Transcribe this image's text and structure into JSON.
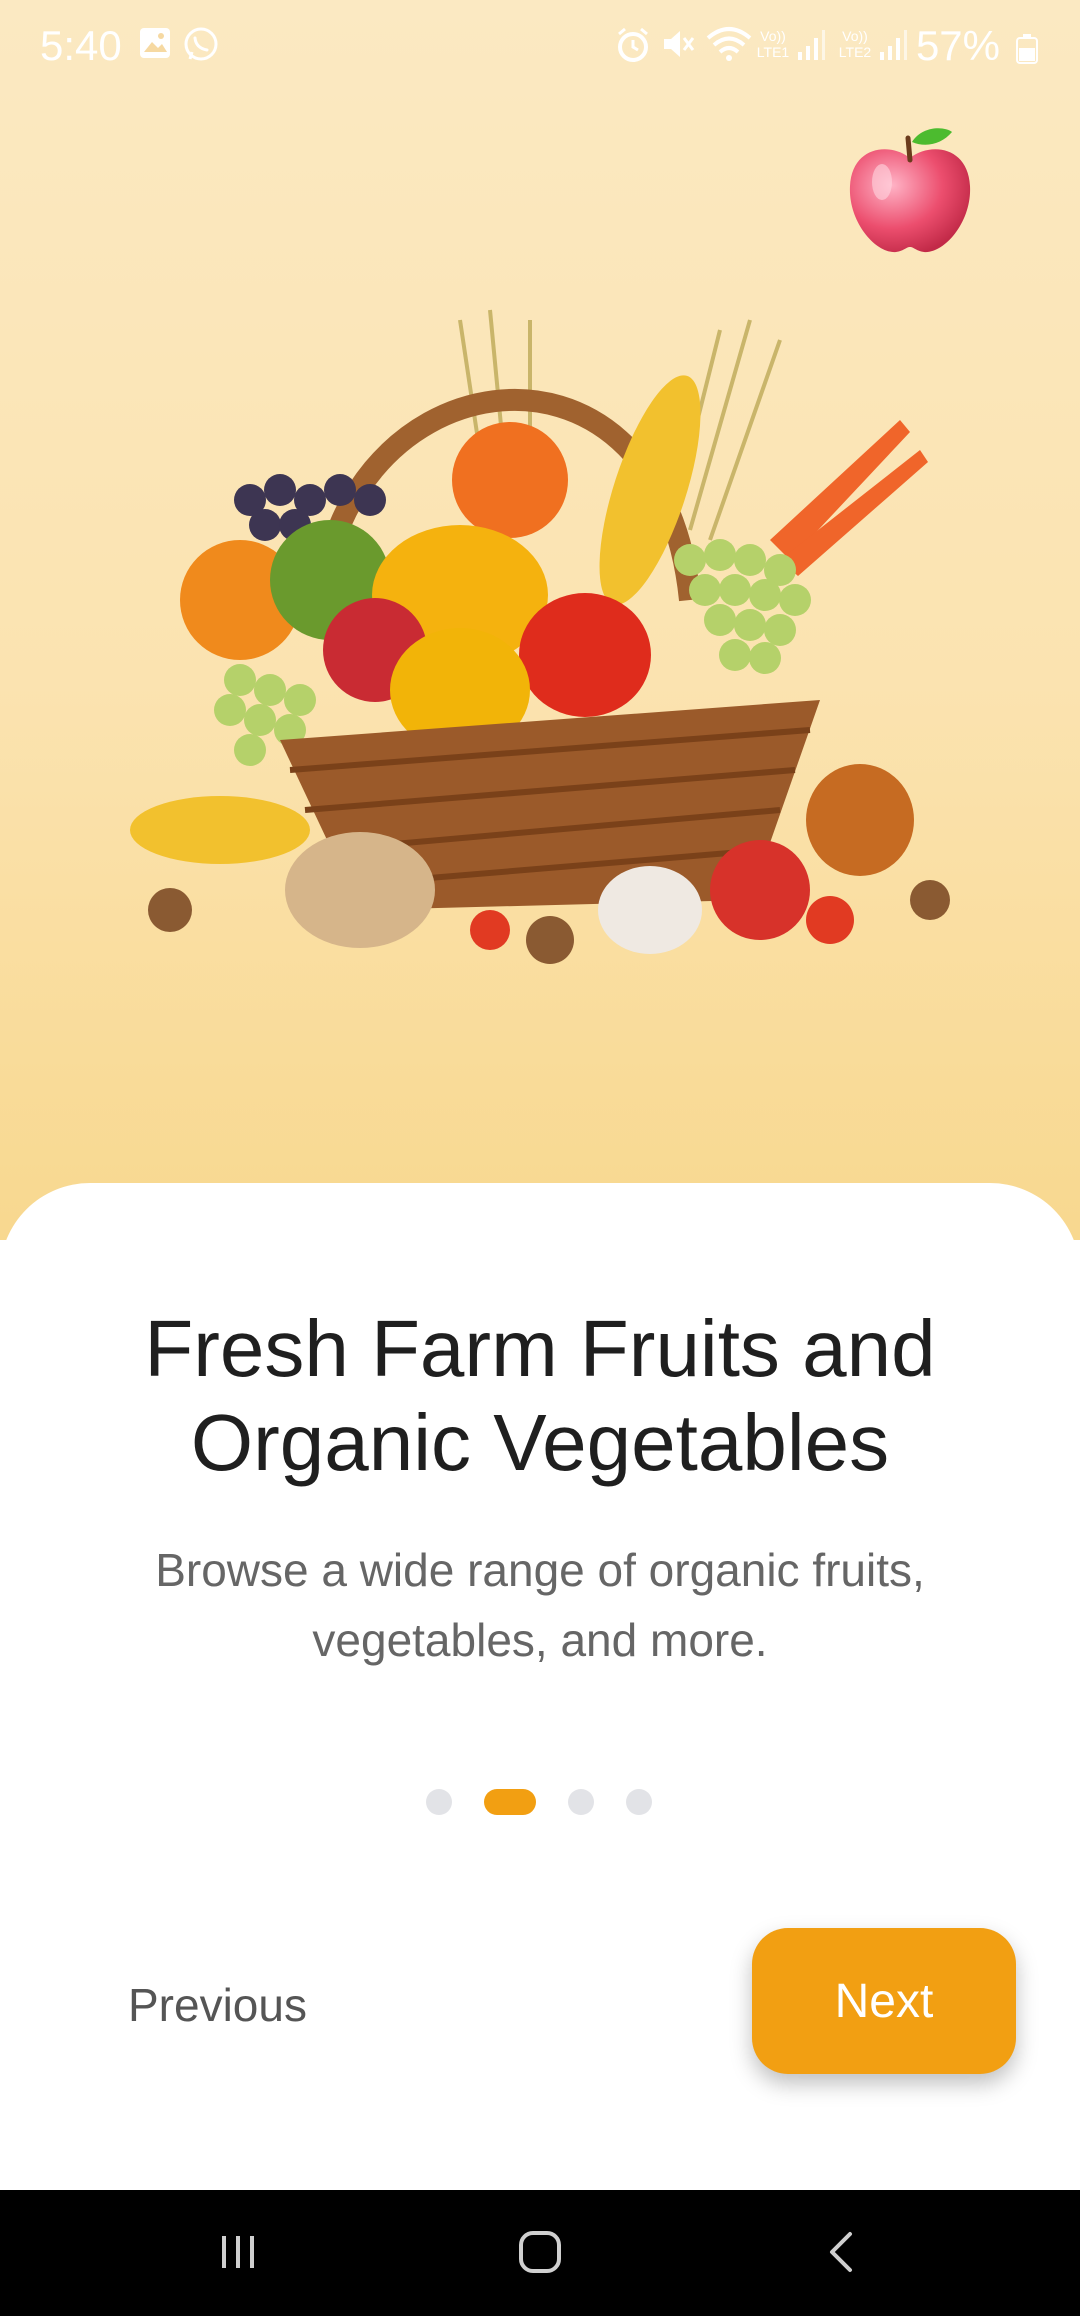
{
  "status_bar": {
    "time": "5:40",
    "battery": "57%",
    "icons": [
      "gallery-icon",
      "whatsapp-icon",
      "alarm-icon",
      "mute-icon",
      "wifi-icon",
      "signal-lte1-icon",
      "signal-lte2-icon",
      "battery-icon"
    ],
    "lte1": "Vo)) LTE1",
    "lte2": "Vo)) LTE2"
  },
  "hero": {
    "icon": "apple-icon",
    "illustration": "fruit-vegetable-basket"
  },
  "onboarding": {
    "title_line1": "Fresh Farm Fruits and",
    "title_line2": "Organic Vegetables",
    "subtitle_line1": "Browse a wide range of organic fruits,",
    "subtitle_line2": "vegetables, and more.",
    "page_count": 4,
    "active_page": 2
  },
  "actions": {
    "previous_label": "Previous",
    "next_label": "Next"
  },
  "colors": {
    "accent": "#f29f12",
    "hero_bg": "#fbe6b8",
    "inactive_dot": "#e2e3e7"
  },
  "nav_bar": {
    "icons": [
      "recent-apps-icon",
      "home-icon",
      "back-icon"
    ]
  }
}
